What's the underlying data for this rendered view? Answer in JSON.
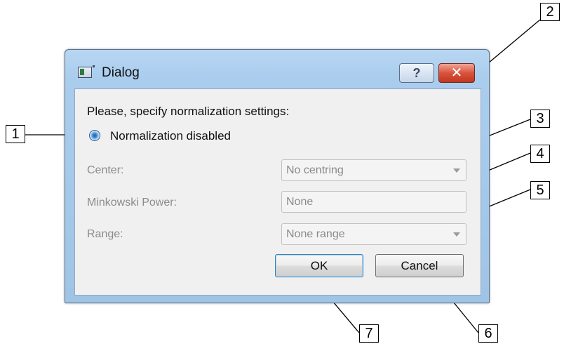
{
  "window": {
    "title": "Dialog",
    "help_glyph": "?",
    "close_glyph": "✕"
  },
  "dialog": {
    "prompt": "Please, specify normalization settings:",
    "radio_label": "Normalization disabled",
    "center_label": "Center:",
    "center_value": "No centring",
    "minkowski_label": "Minkowski Power:",
    "minkowski_value": "None",
    "range_label": "Range:",
    "range_value": "None range",
    "ok_label": "OK",
    "cancel_label": "Cancel"
  },
  "callouts": [
    "1",
    "2",
    "3",
    "4",
    "5",
    "6",
    "7"
  ],
  "icons": {
    "app": "dialog-app-icon",
    "help": "question-mark-icon",
    "close": "close-x-icon",
    "combo": "chevron-down-icon"
  },
  "colors": {
    "close_button": "#c94a32",
    "titlebar": "#aacdee",
    "client": "#f0f0f0",
    "radio_selected": "#1d5fb0"
  }
}
